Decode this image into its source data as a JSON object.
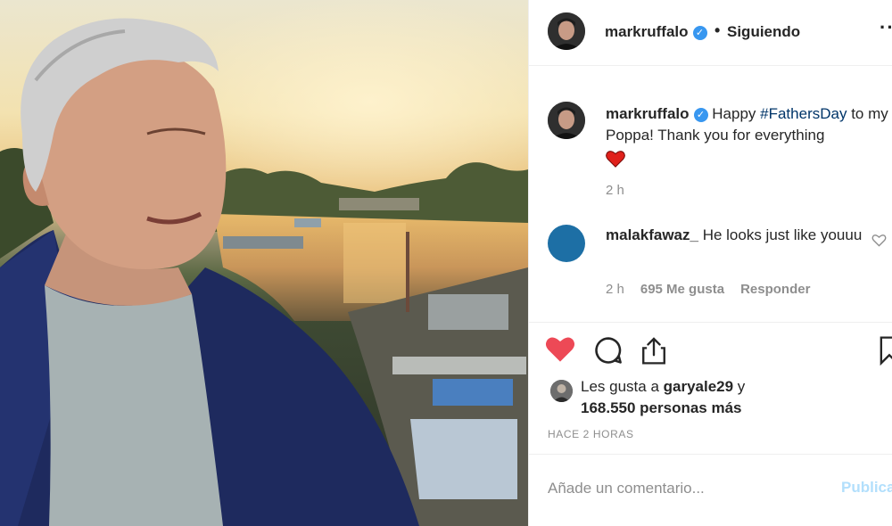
{
  "post": {
    "image_alt": "",
    "author": "markruffalo",
    "follow_separator": "•",
    "follow_status": "Siguiendo",
    "more_label": "···"
  },
  "caption": {
    "username": "markruffalo",
    "text_before": "Happy ",
    "hashtag": "#FathersDay",
    "text_after": " to my Poppa! Thank you for everything",
    "emoji": "red-heart",
    "time": "2 h"
  },
  "comment": {
    "username": "malakfawaz_",
    "text": "He looks just like youuu",
    "time": "2 h",
    "likes": "695 Me gusta",
    "reply_label": "Responder"
  },
  "actions": {
    "like_icon": "heart-filled-icon",
    "comment_icon": "comment-icon",
    "share_icon": "share-icon",
    "save_icon": "bookmark-icon"
  },
  "likes": {
    "prefix": "Les gusta a ",
    "first_user": "garyale29",
    "connector": " y",
    "count_text": "168.550 personas más"
  },
  "posted_ago": "HACE 2 HORAS",
  "comment_bar": {
    "placeholder": "Añade un comentario...",
    "publish_label": "Publicar"
  },
  "colors": {
    "like_red": "#ed4956",
    "hashtag_blue": "#003569",
    "verified_blue": "#3897f0",
    "publish_disabled": "#b2dffc",
    "secondary_text": "#8e8e8e"
  }
}
